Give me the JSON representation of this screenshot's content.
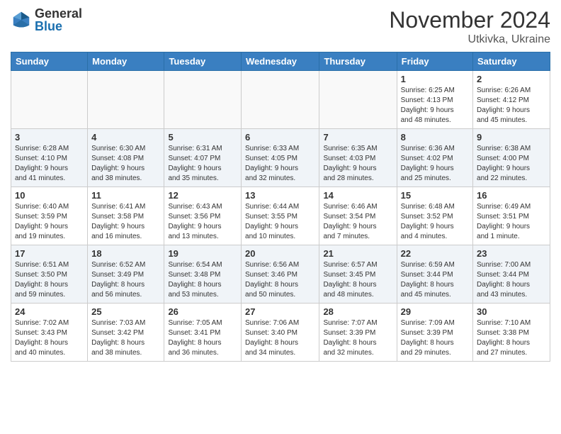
{
  "logo": {
    "general": "General",
    "blue": "Blue"
  },
  "title": "November 2024",
  "location": "Utkivka, Ukraine",
  "days_of_week": [
    "Sunday",
    "Monday",
    "Tuesday",
    "Wednesday",
    "Thursday",
    "Friday",
    "Saturday"
  ],
  "weeks": [
    [
      {
        "day": "",
        "content": ""
      },
      {
        "day": "",
        "content": ""
      },
      {
        "day": "",
        "content": ""
      },
      {
        "day": "",
        "content": ""
      },
      {
        "day": "",
        "content": ""
      },
      {
        "day": "1",
        "content": "Sunrise: 6:25 AM\nSunset: 4:13 PM\nDaylight: 9 hours\nand 48 minutes."
      },
      {
        "day": "2",
        "content": "Sunrise: 6:26 AM\nSunset: 4:12 PM\nDaylight: 9 hours\nand 45 minutes."
      }
    ],
    [
      {
        "day": "3",
        "content": "Sunrise: 6:28 AM\nSunset: 4:10 PM\nDaylight: 9 hours\nand 41 minutes."
      },
      {
        "day": "4",
        "content": "Sunrise: 6:30 AM\nSunset: 4:08 PM\nDaylight: 9 hours\nand 38 minutes."
      },
      {
        "day": "5",
        "content": "Sunrise: 6:31 AM\nSunset: 4:07 PM\nDaylight: 9 hours\nand 35 minutes."
      },
      {
        "day": "6",
        "content": "Sunrise: 6:33 AM\nSunset: 4:05 PM\nDaylight: 9 hours\nand 32 minutes."
      },
      {
        "day": "7",
        "content": "Sunrise: 6:35 AM\nSunset: 4:03 PM\nDaylight: 9 hours\nand 28 minutes."
      },
      {
        "day": "8",
        "content": "Sunrise: 6:36 AM\nSunset: 4:02 PM\nDaylight: 9 hours\nand 25 minutes."
      },
      {
        "day": "9",
        "content": "Sunrise: 6:38 AM\nSunset: 4:00 PM\nDaylight: 9 hours\nand 22 minutes."
      }
    ],
    [
      {
        "day": "10",
        "content": "Sunrise: 6:40 AM\nSunset: 3:59 PM\nDaylight: 9 hours\nand 19 minutes."
      },
      {
        "day": "11",
        "content": "Sunrise: 6:41 AM\nSunset: 3:58 PM\nDaylight: 9 hours\nand 16 minutes."
      },
      {
        "day": "12",
        "content": "Sunrise: 6:43 AM\nSunset: 3:56 PM\nDaylight: 9 hours\nand 13 minutes."
      },
      {
        "day": "13",
        "content": "Sunrise: 6:44 AM\nSunset: 3:55 PM\nDaylight: 9 hours\nand 10 minutes."
      },
      {
        "day": "14",
        "content": "Sunrise: 6:46 AM\nSunset: 3:54 PM\nDaylight: 9 hours\nand 7 minutes."
      },
      {
        "day": "15",
        "content": "Sunrise: 6:48 AM\nSunset: 3:52 PM\nDaylight: 9 hours\nand 4 minutes."
      },
      {
        "day": "16",
        "content": "Sunrise: 6:49 AM\nSunset: 3:51 PM\nDaylight: 9 hours\nand 1 minute."
      }
    ],
    [
      {
        "day": "17",
        "content": "Sunrise: 6:51 AM\nSunset: 3:50 PM\nDaylight: 8 hours\nand 59 minutes."
      },
      {
        "day": "18",
        "content": "Sunrise: 6:52 AM\nSunset: 3:49 PM\nDaylight: 8 hours\nand 56 minutes."
      },
      {
        "day": "19",
        "content": "Sunrise: 6:54 AM\nSunset: 3:48 PM\nDaylight: 8 hours\nand 53 minutes."
      },
      {
        "day": "20",
        "content": "Sunrise: 6:56 AM\nSunset: 3:46 PM\nDaylight: 8 hours\nand 50 minutes."
      },
      {
        "day": "21",
        "content": "Sunrise: 6:57 AM\nSunset: 3:45 PM\nDaylight: 8 hours\nand 48 minutes."
      },
      {
        "day": "22",
        "content": "Sunrise: 6:59 AM\nSunset: 3:44 PM\nDaylight: 8 hours\nand 45 minutes."
      },
      {
        "day": "23",
        "content": "Sunrise: 7:00 AM\nSunset: 3:44 PM\nDaylight: 8 hours\nand 43 minutes."
      }
    ],
    [
      {
        "day": "24",
        "content": "Sunrise: 7:02 AM\nSunset: 3:43 PM\nDaylight: 8 hours\nand 40 minutes."
      },
      {
        "day": "25",
        "content": "Sunrise: 7:03 AM\nSunset: 3:42 PM\nDaylight: 8 hours\nand 38 minutes."
      },
      {
        "day": "26",
        "content": "Sunrise: 7:05 AM\nSunset: 3:41 PM\nDaylight: 8 hours\nand 36 minutes."
      },
      {
        "day": "27",
        "content": "Sunrise: 7:06 AM\nSunset: 3:40 PM\nDaylight: 8 hours\nand 34 minutes."
      },
      {
        "day": "28",
        "content": "Sunrise: 7:07 AM\nSunset: 3:39 PM\nDaylight: 8 hours\nand 32 minutes."
      },
      {
        "day": "29",
        "content": "Sunrise: 7:09 AM\nSunset: 3:39 PM\nDaylight: 8 hours\nand 29 minutes."
      },
      {
        "day": "30",
        "content": "Sunrise: 7:10 AM\nSunset: 3:38 PM\nDaylight: 8 hours\nand 27 minutes."
      }
    ]
  ]
}
